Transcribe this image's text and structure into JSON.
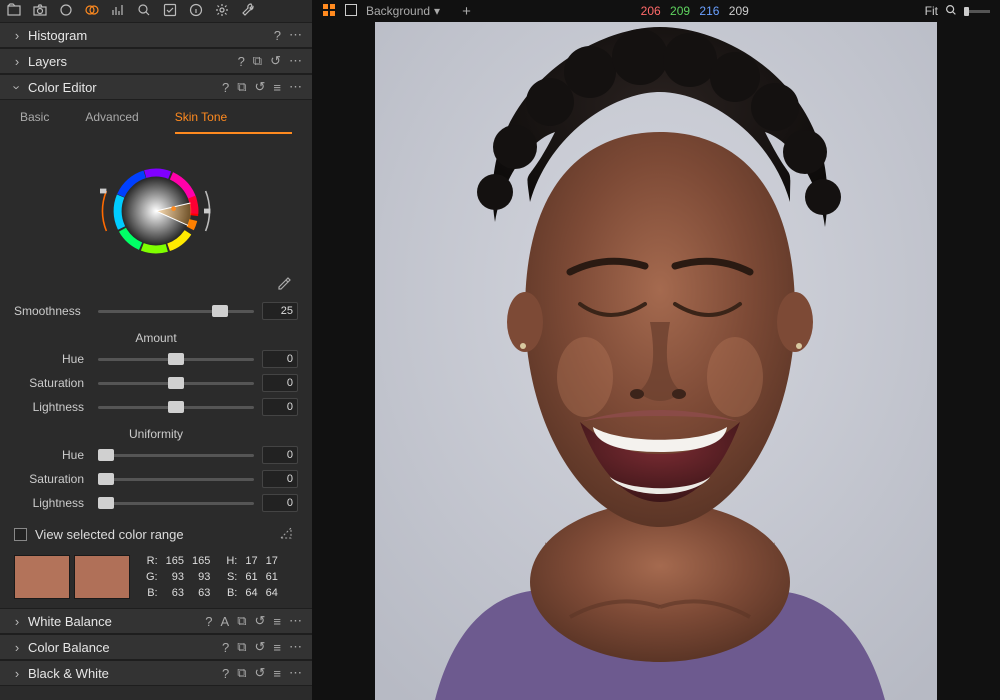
{
  "sidebar": {
    "panels": {
      "histogram": {
        "title": "Histogram"
      },
      "layers": {
        "title": "Layers"
      },
      "color_editor": {
        "title": "Color Editor",
        "tabs": {
          "basic": "Basic",
          "advanced": "Advanced",
          "skin": "Skin Tone"
        },
        "smoothness": {
          "label": "Smoothness",
          "value": "25"
        },
        "amount_label": "Amount",
        "uniformity_label": "Uniformity",
        "amount": {
          "hue": {
            "label": "Hue",
            "value": "0"
          },
          "saturation": {
            "label": "Saturation",
            "value": "0"
          },
          "lightness": {
            "label": "Lightness",
            "value": "0"
          }
        },
        "uniformity": {
          "hue": {
            "label": "Hue",
            "value": "0"
          },
          "saturation": {
            "label": "Saturation",
            "value": "0"
          },
          "lightness": {
            "label": "Lightness",
            "value": "0"
          }
        },
        "view_range": "View selected color range",
        "readout": {
          "r1": "165",
          "r2": "165",
          "g1": "93",
          "g2": "93",
          "b1": "63",
          "b2": "63",
          "h1": "17",
          "h2": "17",
          "s1": "61",
          "s2": "61",
          "br1": "64",
          "br2": "64"
        }
      },
      "white_balance": {
        "title": "White Balance"
      },
      "color_balance": {
        "title": "Color Balance"
      },
      "black_white": {
        "title": "Black & White"
      }
    }
  },
  "viewer": {
    "background_label": "Background",
    "rgb": {
      "r": "206",
      "g": "209",
      "b": "216",
      "l": "209"
    },
    "fit_label": "Fit"
  },
  "labels": {
    "R": "R:",
    "G": "G:",
    "B": "B:",
    "H": "H:",
    "S": "S:",
    "Br": "B:"
  },
  "swatch_color": "#b3735a"
}
